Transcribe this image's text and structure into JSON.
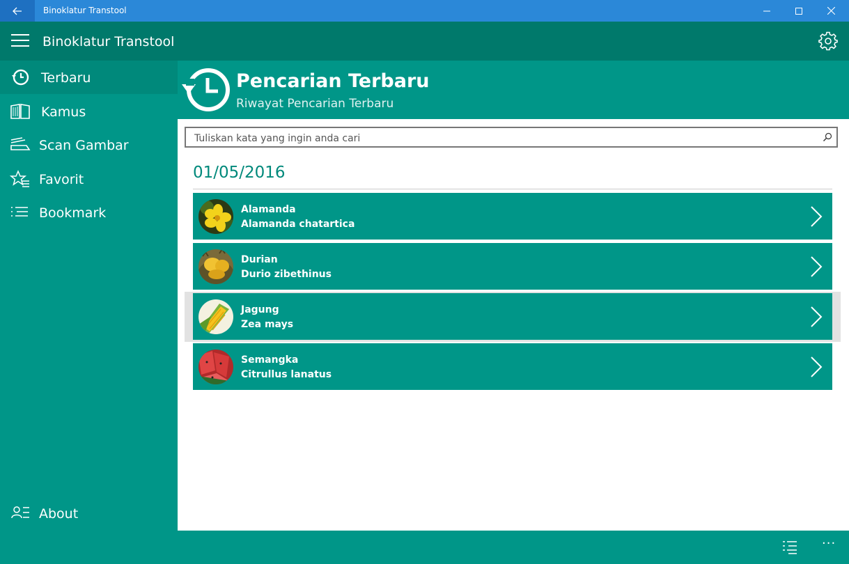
{
  "window": {
    "title": "Binoklatur Transtool"
  },
  "appbar": {
    "title": "Binoklatur Transtool"
  },
  "sidebar": {
    "items": [
      {
        "label": "Terbaru",
        "icon": "history-icon",
        "selected": true
      },
      {
        "label": "Kamus",
        "icon": "book-icon"
      },
      {
        "label": "Scan Gambar",
        "icon": "scan-icon"
      },
      {
        "label": "Favorit",
        "icon": "star-list-icon"
      },
      {
        "label": "Bookmark",
        "icon": "bookmark-list-icon"
      }
    ],
    "about": {
      "label": "About",
      "icon": "contact-icon"
    }
  },
  "header": {
    "title": "Pencarian Terbaru",
    "subtitle": "Riwayat Pencarian Terbaru"
  },
  "search": {
    "placeholder": "Tuliskan kata yang ingin anda cari",
    "value": ""
  },
  "history": {
    "date": "01/05/2016",
    "items": [
      {
        "name": "Alamanda",
        "scientific": "Alamanda chatartica",
        "image": "yellow-flower"
      },
      {
        "name": "Durian",
        "scientific": "Durio zibethinus",
        "image": "durian-fruit"
      },
      {
        "name": "Jagung",
        "scientific": "Zea mays",
        "image": "corn"
      },
      {
        "name": "Semangka",
        "scientific": "Citrullus lanatus",
        "image": "watermelon"
      }
    ]
  },
  "colors": {
    "primary": "#009688",
    "primary_dark": "#00796b",
    "titlebar": "#2b88d8",
    "accent_text": "#00897b"
  }
}
